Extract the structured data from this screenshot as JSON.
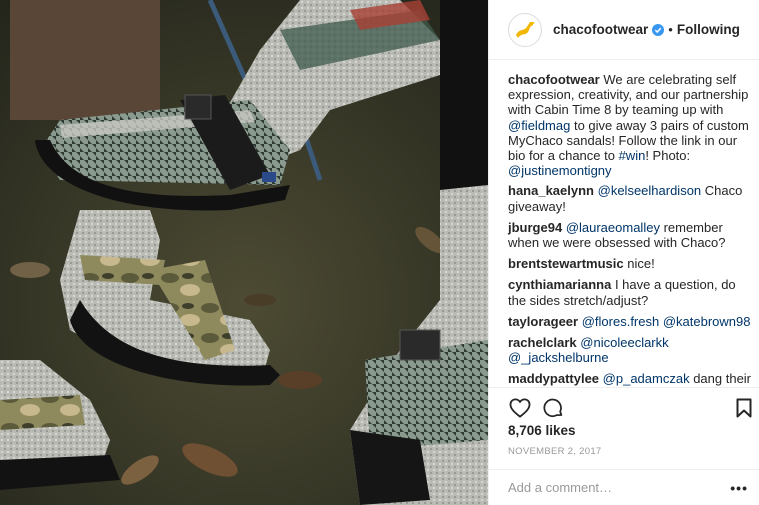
{
  "post": {
    "image_alt": "Feet wearing patterned wool socks and Chaco sandals on autumn grass",
    "header": {
      "username": "chacofootwear",
      "separator": "•",
      "follow_label": "Following",
      "avatar_icon": "chaco-logo-icon",
      "verified_icon": "verified-badge-icon"
    },
    "caption": {
      "username": "chacofootwear",
      "segments": [
        {
          "text": "We are celebrating self expression, creativity, and our partnership with Cabin Time 8 by teaming up with ",
          "mention": false
        },
        {
          "text": "@fieldmag",
          "mention": true
        },
        {
          "text": " to give away 3 pairs of custom MyChaco sandals! Follow the link in our bio for a chance to ",
          "mention": false
        },
        {
          "text": "#win",
          "mention": true
        },
        {
          "text": "! Photo: ",
          "mention": false
        },
        {
          "text": "@justinemontigny",
          "mention": true
        }
      ]
    },
    "comments": [
      {
        "username": "hana_kaelynn",
        "segments": [
          {
            "text": "@kelseelhardison",
            "mention": true
          },
          {
            "text": " Chaco giveaway!",
            "mention": false
          }
        ]
      },
      {
        "username": "jburge94",
        "segments": [
          {
            "text": "@lauraeomalley",
            "mention": true
          },
          {
            "text": " remember when we were obsessed with Chaco?",
            "mention": false
          }
        ]
      },
      {
        "username": "brentstewartmusic",
        "segments": [
          {
            "text": "nice!",
            "mention": false
          }
        ]
      },
      {
        "username": "cynthiamarianna",
        "segments": [
          {
            "text": "I have a question, do the sides stretch/adjust?",
            "mention": false
          }
        ]
      },
      {
        "username": "taylorageer",
        "segments": [
          {
            "text": "@flores.fresh",
            "mention": true
          },
          {
            "text": " ",
            "mention": false
          },
          {
            "text": "@katebrown98",
            "mention": true
          }
        ]
      },
      {
        "username": "rachelclark",
        "segments": [
          {
            "text": "@nicoleeclarkk",
            "mention": true
          },
          {
            "text": " ",
            "mention": false
          },
          {
            "text": "@_jackshelburne",
            "mention": true
          }
        ]
      },
      {
        "username": "maddypattylee",
        "segments": [
          {
            "text": "@p_adamczak",
            "mention": true
          },
          {
            "text": " dang their feet look REAL warm. I bet they're in",
            "mention": false
          }
        ]
      }
    ],
    "actions": {
      "like_icon": "heart-icon",
      "comment_icon": "speech-bubble-icon",
      "save_icon": "bookmark-icon"
    },
    "likes_label": "8,706 likes",
    "timestamp": "NOVEMBER 2, 2017",
    "add_comment": {
      "placeholder": "Add a comment…",
      "more_label": "•••"
    }
  },
  "colors": {
    "text": "#262626",
    "mention": "#003569",
    "muted": "#999999",
    "border": "#efefef",
    "verified": "#3897f0",
    "brand_yellow": "#f2b705"
  }
}
